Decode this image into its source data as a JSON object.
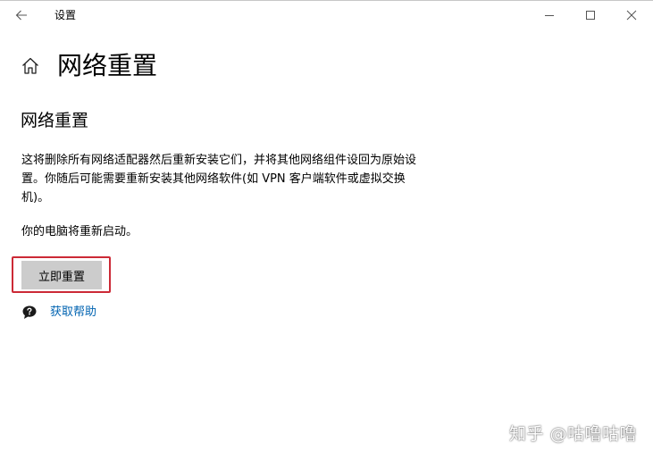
{
  "window": {
    "title": "设置"
  },
  "page": {
    "title": "网络重置"
  },
  "section": {
    "title": "网络重置",
    "description": "这将删除所有网络适配器然后重新安装它们，并将其他网络组件设回为原始设置。你随后可能需要重新安装其他网络软件(如 VPN 客户端软件或虚拟交换机)。",
    "restart_note": "你的电脑将重新启动。",
    "reset_button_label": "立即重置",
    "help_link_label": "获取帮助"
  },
  "watermark": {
    "text": "知乎 @咕噜咕噜"
  },
  "icons": {
    "back": "back-arrow-icon",
    "minimize": "minimize-icon",
    "maximize": "maximize-icon",
    "close": "close-icon",
    "home": "home-icon",
    "help": "help-chat-icon"
  },
  "colors": {
    "highlight_frame": "#cc2a36",
    "link": "#0063b1",
    "button_bg": "#cccccc"
  }
}
